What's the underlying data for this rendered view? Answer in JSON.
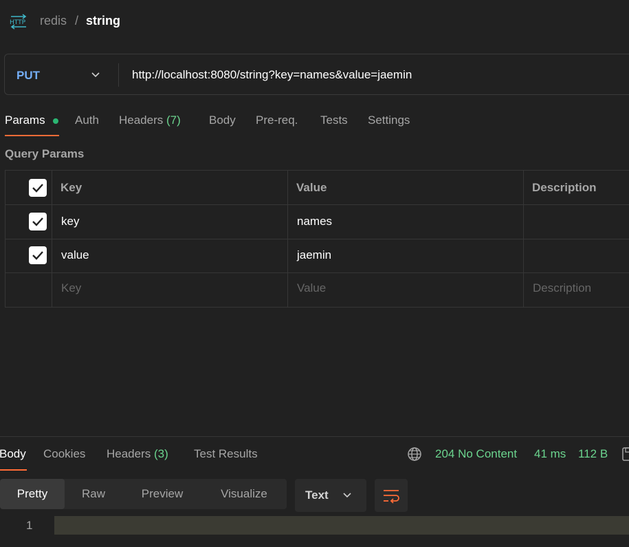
{
  "breadcrumb": {
    "icon": "http-icon",
    "parent": "redis",
    "separator": "/",
    "current": "string"
  },
  "request": {
    "method": "PUT",
    "url": "http://localhost:8080/string?key=names&value=jaemin"
  },
  "request_tabs": {
    "params": "Params",
    "auth": "Auth",
    "headers": "Headers",
    "headers_count": "(7)",
    "body": "Body",
    "prereq": "Pre-req.",
    "tests": "Tests",
    "settings": "Settings",
    "active": "Params"
  },
  "query_params": {
    "title": "Query Params",
    "columns": {
      "key": "Key",
      "value": "Value",
      "description": "Description"
    },
    "rows": [
      {
        "checked": true,
        "key": "key",
        "value": "names",
        "description": ""
      },
      {
        "checked": true,
        "key": "value",
        "value": "jaemin",
        "description": ""
      }
    ],
    "placeholder": {
      "key": "Key",
      "value": "Value",
      "description": "Description"
    }
  },
  "response": {
    "tabs": {
      "body": "Body",
      "cookies": "Cookies",
      "headers": "Headers",
      "headers_count": "(3)",
      "test_results": "Test Results",
      "active": "Body"
    },
    "status": "204 No Content",
    "time": "41 ms",
    "size": "112 B",
    "views": {
      "pretty": "Pretty",
      "raw": "Raw",
      "preview": "Preview",
      "visualize": "Visualize",
      "active": "Pretty"
    },
    "format": "Text",
    "editor": {
      "line_number": "1"
    }
  },
  "colors": {
    "background": "#212121",
    "accent": "#ff6c37",
    "method": "#74aef6",
    "success": "#6bd48e",
    "dot": "#2bb673"
  }
}
